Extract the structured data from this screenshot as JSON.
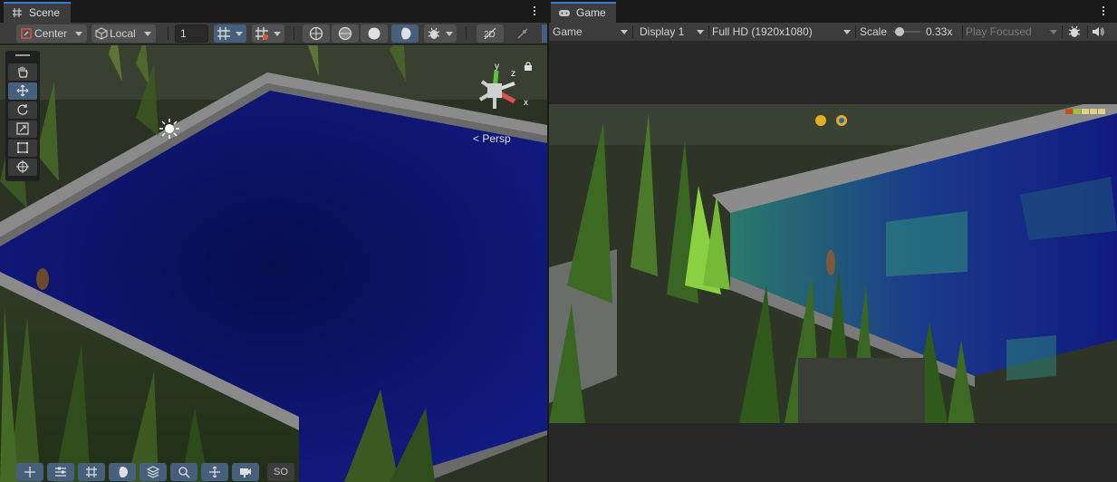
{
  "scene": {
    "tab_label": "Scene",
    "pivot_mode": "Center",
    "pivot_rotation": "Local",
    "grid_snap_value": "1",
    "orientation_label": "Persp",
    "gizmo_axes": {
      "y": "y",
      "z": "z",
      "x": "x"
    },
    "bottom_label": "SO",
    "icons": {
      "tab": "hash-icon",
      "menu": "kebab-menu-icon",
      "tools": [
        "hand-icon",
        "move-icon",
        "rotate-icon",
        "scale-icon",
        "rect-icon",
        "transform-icon"
      ],
      "bottom_tools": [
        "move-icon",
        "sliders-icon",
        "grid-icon",
        "shading-icon",
        "layers-icon",
        "search-icon",
        "navigate-icon",
        "camera-icon"
      ]
    }
  },
  "game": {
    "tab_label": "Game",
    "view_mode": "Game",
    "display": "Display 1",
    "resolution": "Full HD (1920x1080)",
    "scale_label": "Scale",
    "scale_value": "0.33x",
    "play_mode": "Play Focused",
    "scale_fraction": 0.08,
    "icons": {
      "tab": "gamepad-icon",
      "bug": "bug-icon",
      "audio": "speaker-icon",
      "menu": "kebab-menu-icon"
    }
  },
  "colors": {
    "accent": "#3a7bd5",
    "water": "#101678",
    "grass": "#3c5a20"
  }
}
